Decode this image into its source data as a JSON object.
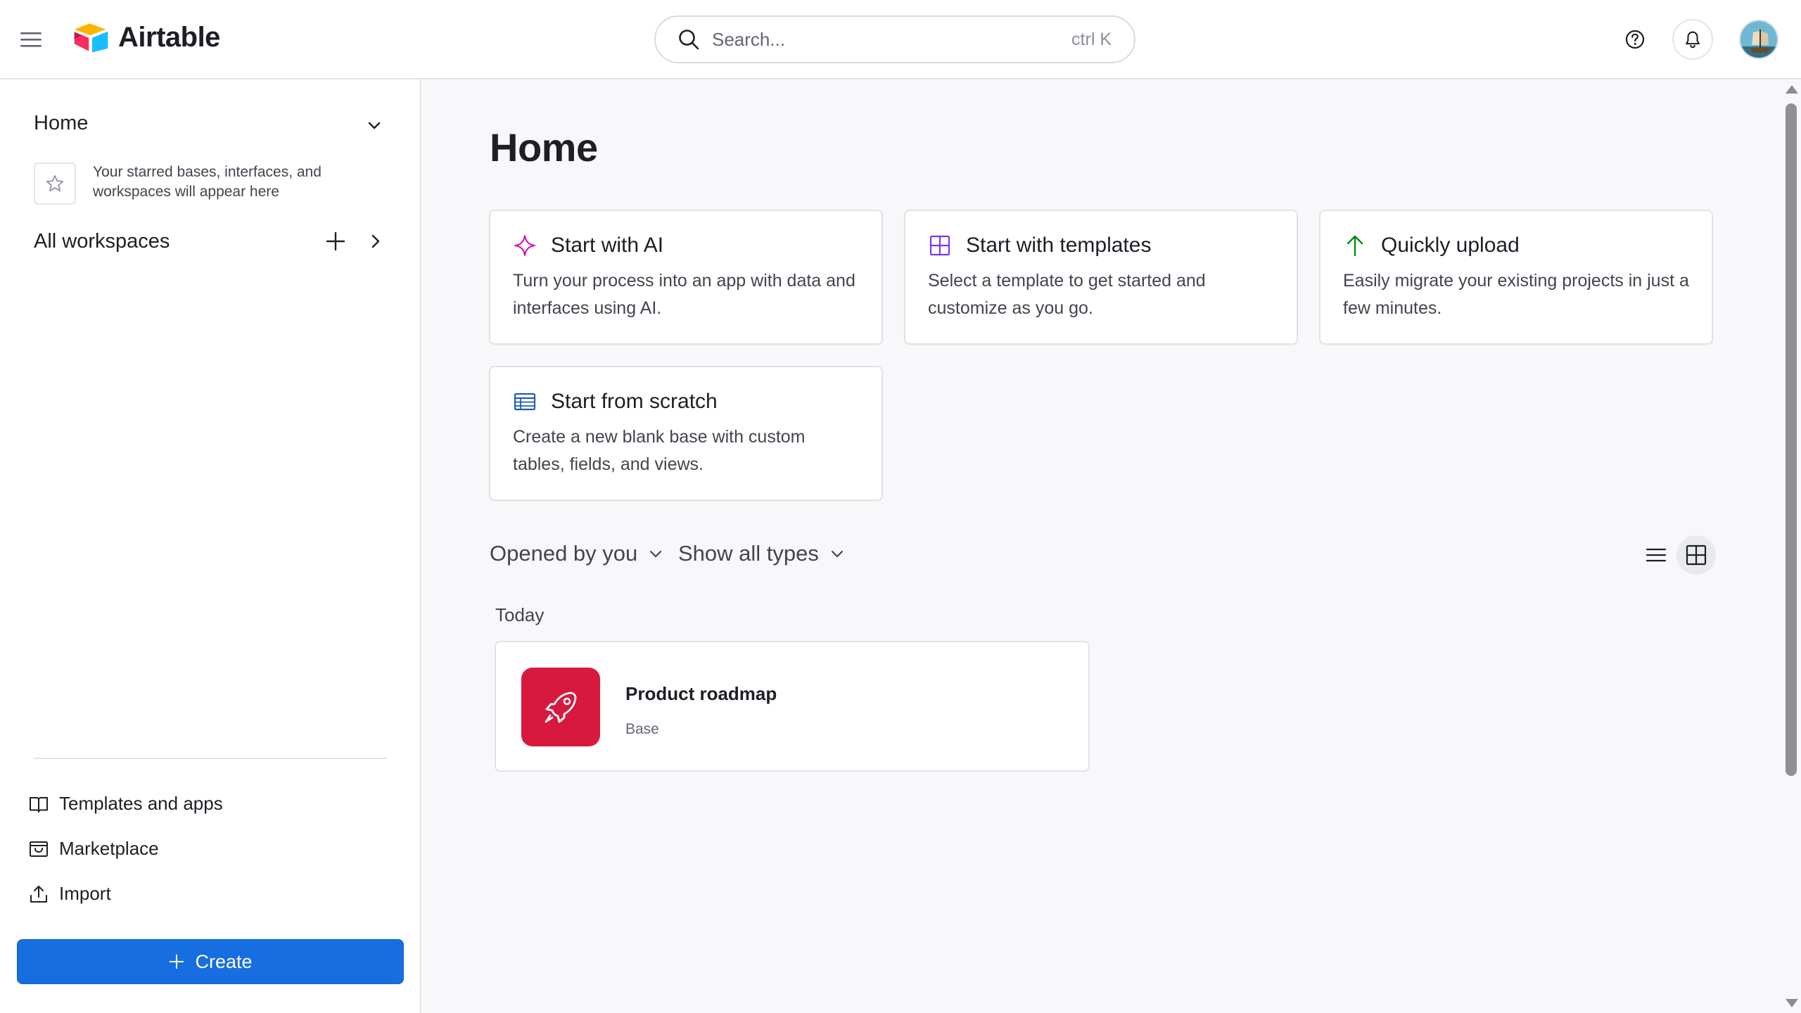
{
  "app": {
    "name": "Airtable"
  },
  "search": {
    "placeholder": "Search...",
    "shortcut": "ctrl K"
  },
  "sidebar": {
    "home_label": "Home",
    "starred_note": "Your starred bases, interfaces, and workspaces will appear here",
    "all_workspaces_label": "All workspaces",
    "links": [
      {
        "label": "Templates and apps",
        "icon": "book-open-icon"
      },
      {
        "label": "Marketplace",
        "icon": "storefront-icon"
      },
      {
        "label": "Import",
        "icon": "upload-icon"
      }
    ],
    "create_label": "Create"
  },
  "main": {
    "title": "Home",
    "cards": [
      {
        "title": "Start with AI",
        "description": "Turn your process into an app with data and interfaces using AI.",
        "icon": "sparkle-icon",
        "icon_color": "#dd04a8"
      },
      {
        "title": "Start with templates",
        "description": "Select a template to get started and customize as you go.",
        "icon": "grid-four-icon",
        "icon_color": "#7c37ef"
      },
      {
        "title": "Quickly upload",
        "description": "Easily migrate your existing projects in just a few minutes.",
        "icon": "arrow-up-icon",
        "icon_color": "#048a0e"
      },
      {
        "title": "Start from scratch",
        "description": "Create a new blank base with custom tables, fields, and views.",
        "icon": "table-icon",
        "icon_color": "#1f5eb5"
      }
    ],
    "filters": {
      "opened_by": "Opened by you",
      "type": "Show all types"
    },
    "view_mode": "grid",
    "section_label": "Today",
    "bases": [
      {
        "name": "Product roadmap",
        "type": "Base",
        "icon": "rocket-icon",
        "color": "#d6193c"
      }
    ]
  },
  "colors": {
    "accent": "#166ee1",
    "border": "#e1e2e6",
    "main_bg": "#f8f8fa"
  }
}
